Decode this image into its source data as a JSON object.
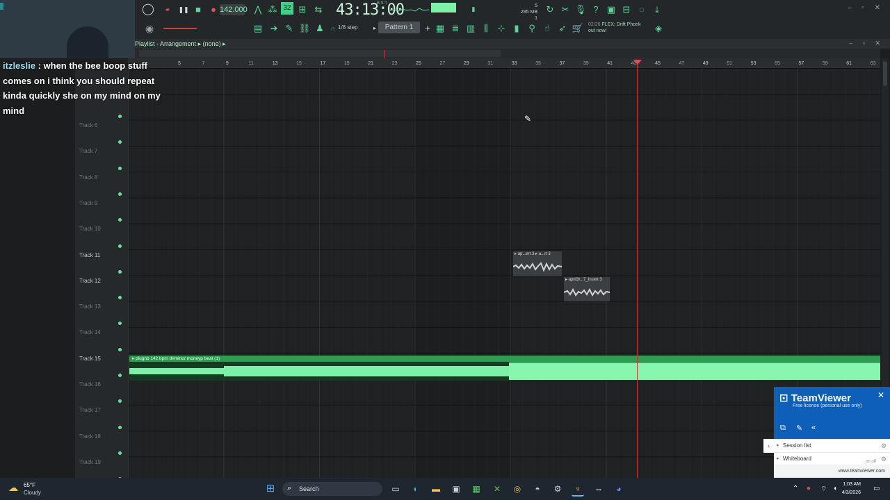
{
  "toolbar": {
    "tempo": "142.000",
    "timecode": "43:13:00",
    "timecode_sub": "B:S:T",
    "memory": "285 MB",
    "memory_cpu": "5",
    "memory_poly": "1",
    "step": "1/6 step",
    "pattern": "Pattern 1",
    "news_date": "02/26",
    "news_text": "FLEX: Drift Phonk",
    "news_text2": "out now!",
    "accent": "#5fd39a"
  },
  "playlist": {
    "title": "Playlist - Arrangement",
    "selection": "(none)",
    "ruler_labels": [
      "5",
      "7",
      "9",
      "11",
      "13",
      "15",
      "17",
      "19",
      "21",
      "23",
      "25",
      "27",
      "29",
      "31",
      "33",
      "35",
      "37",
      "39",
      "41",
      "43",
      "45",
      "47",
      "49",
      "51",
      "53",
      "55",
      "57",
      "59",
      "61",
      "63"
    ],
    "tracks": [
      {
        "name": "Track 6",
        "bright": false
      },
      {
        "name": "Track 7",
        "bright": false
      },
      {
        "name": "Track 8",
        "bright": false
      },
      {
        "name": "Track 9",
        "bright": false
      },
      {
        "name": "Track 10",
        "bright": false
      },
      {
        "name": "Track 11",
        "bright": true
      },
      {
        "name": "Track 12",
        "bright": true
      },
      {
        "name": "Track 13",
        "bright": false
      },
      {
        "name": "Track 14",
        "bright": false
      },
      {
        "name": "Track 15",
        "bright": true
      },
      {
        "name": "Track 16",
        "bright": false
      },
      {
        "name": "Track 17",
        "bright": false
      },
      {
        "name": "Track 18",
        "bright": false
      },
      {
        "name": "Track 19",
        "bright": false
      }
    ],
    "clips": {
      "clip_a1": "ap...ert 3",
      "clip_a2": "a...rt 3",
      "clip_b": "april3r...7_Insert 3",
      "clip_big": "plugnb 142 bpm d#minor moneyp beat (1)"
    }
  },
  "chat": {
    "user": "itzleslie",
    "message": " : when the bee boop stuff comes on i think you should repeat kinda quickly she on my mind on my mind"
  },
  "teamviewer": {
    "brand": "TeamViewer",
    "license": "Free license (personal use only)",
    "session_list": "Session list",
    "whiteboard": "Whiteboard",
    "toggle": "on  off",
    "url": "www.teamviewer.com"
  },
  "taskbar": {
    "temperature": "65°F",
    "weather": "Cloudy",
    "search": "Search",
    "time": "1:03 AM",
    "date": "4/3/2026"
  }
}
